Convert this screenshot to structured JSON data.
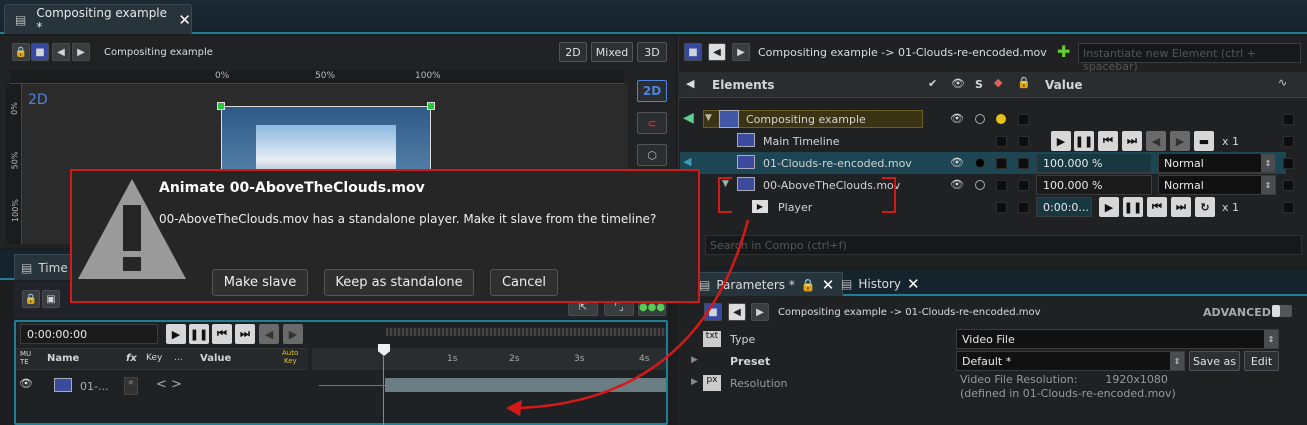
{
  "doc_tab": {
    "title": "Compositing example *"
  },
  "left_toolbar": {
    "breadcrumb": "Compositing example",
    "mode_2d": "2D",
    "mode_mixed": "Mixed",
    "mode_3d": "3D"
  },
  "ruler": {
    "top_ticks": [
      "0%",
      "50%",
      "100%"
    ],
    "left_ticks": [
      "0%",
      "50%",
      "100%"
    ]
  },
  "viewport": {
    "label": "2D",
    "side_2d": "2D"
  },
  "right_toolbar": {
    "breadcrumb": "Compositing example -> 01-Clouds-re-encoded.mov",
    "instantiate_placeholder": "Instantiate new Element (ctrl + spacebar)"
  },
  "elements_header": {
    "elements": "Elements",
    "s": "S",
    "value": "Value"
  },
  "elements": {
    "compositing": "Compositing example",
    "main_timeline": "Main Timeline",
    "main_timeline_loop": "x 1",
    "clouds": "01-Clouds-re-encoded.mov",
    "clouds_value": "100.000 %",
    "clouds_blend": "Normal",
    "above": "00-AboveTheClouds.mov",
    "above_value": "100.000 %",
    "above_blend": "Normal",
    "player": "Player",
    "player_time": "0:00:0...",
    "player_loop": "x 1"
  },
  "search": {
    "placeholder": "Search in Compo (ctrl+f)"
  },
  "bottom_tabs": {
    "parameters": "Parameters *",
    "history": "History"
  },
  "params": {
    "breadcrumb": "Compositing example -> 01-Clouds-re-encoded.mov",
    "advanced": "ADVANCED",
    "type_icon": "txt",
    "type_label": "Type",
    "type_value": "Video File",
    "preset_label": "Preset",
    "preset_value": "Default *",
    "save_as": "Save as",
    "edit": "Edit",
    "res_icon": "px",
    "res_label": "Resolution",
    "res_line1": "Video File Resolution:        1920x1080",
    "res_line2": "(defined in 01-Clouds-re-encoded.mov)"
  },
  "timeline": {
    "tab": "Time",
    "timecode": "0:00:00:00",
    "col_mute_1": "MU",
    "col_mute_2": "TE",
    "col_name": "Name",
    "col_fx": "fx",
    "col_key": "Key",
    "col_dots": "...",
    "col_value": "Value",
    "col_auto_1": "Auto",
    "col_auto_2": "Key",
    "ticks": [
      "1s",
      "2s",
      "3s",
      "4s"
    ],
    "row_name": "01-...",
    "row_star": "*"
  },
  "dialog": {
    "title": "Animate 00-AboveTheClouds.mov",
    "message": "00-AboveTheClouds.mov has a standalone player. Make it slave from the timeline?",
    "make_slave": "Make slave",
    "keep_standalone": "Keep as standalone",
    "cancel": "Cancel"
  },
  "colors": {
    "accent": "#1e7f96",
    "dialog_border": "#d21a1a",
    "arrow": "#d21a1a",
    "handle": "#27c53a"
  }
}
